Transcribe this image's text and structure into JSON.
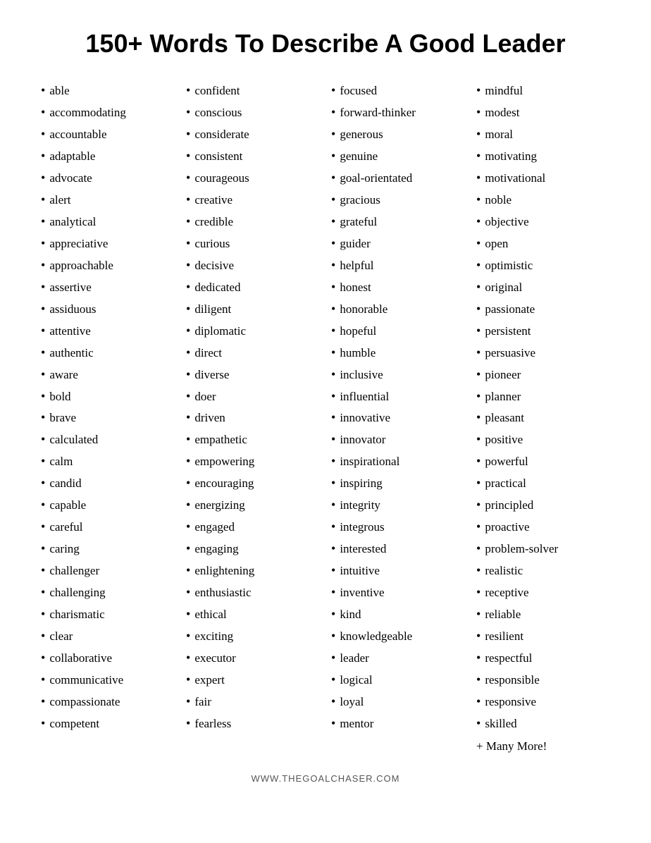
{
  "title": "150+ Words To Describe A Good Leader",
  "columns": [
    {
      "id": "col1",
      "items": [
        "able",
        "accommodating",
        "accountable",
        "adaptable",
        "advocate",
        "alert",
        "analytical",
        "appreciative",
        "approachable",
        "assertive",
        "assiduous",
        "attentive",
        "authentic",
        "aware",
        "bold",
        "brave",
        "calculated",
        "calm",
        "candid",
        "capable",
        "careful",
        "caring",
        "challenger",
        "challenging",
        "charismatic",
        "clear",
        "collaborative",
        "communicative",
        "compassionate",
        "competent"
      ]
    },
    {
      "id": "col2",
      "items": [
        "confident",
        "conscious",
        "considerate",
        "consistent",
        "courageous",
        "creative",
        "credible",
        "curious",
        "decisive",
        "dedicated",
        "diligent",
        "diplomatic",
        "direct",
        "diverse",
        "doer",
        "driven",
        "empathetic",
        "empowering",
        "encouraging",
        "energizing",
        "engaged",
        "engaging",
        "enlightening",
        "enthusiastic",
        "ethical",
        "exciting",
        "executor",
        "expert",
        "fair",
        "fearless"
      ]
    },
    {
      "id": "col3",
      "items": [
        "focused",
        "forward-thinker",
        "generous",
        "genuine",
        "goal-orientated",
        "gracious",
        "grateful",
        "guider",
        "helpful",
        "honest",
        "honorable",
        "hopeful",
        "humble",
        "inclusive",
        "influential",
        "innovative",
        "innovator",
        "inspirational",
        "inspiring",
        "integrity",
        "integrous",
        "interested",
        "intuitive",
        "inventive",
        "kind",
        "knowledgeable",
        "leader",
        "logical",
        "loyal",
        "mentor"
      ]
    },
    {
      "id": "col4",
      "items": [
        "mindful",
        "modest",
        "moral",
        "motivating",
        "motivational",
        "noble",
        "objective",
        "open",
        "optimistic",
        "original",
        "passionate",
        "persistent",
        "persuasive",
        "pioneer",
        "planner",
        "pleasant",
        "positive",
        "powerful",
        "practical",
        "principled",
        "proactive",
        "problem-solver",
        "realistic",
        "receptive",
        "reliable",
        "resilient",
        "respectful",
        "responsible",
        "responsive",
        "skilled"
      ],
      "suffix": "+ Many More!"
    }
  ],
  "footer": "WWW.THEGOALCHASER.COM"
}
